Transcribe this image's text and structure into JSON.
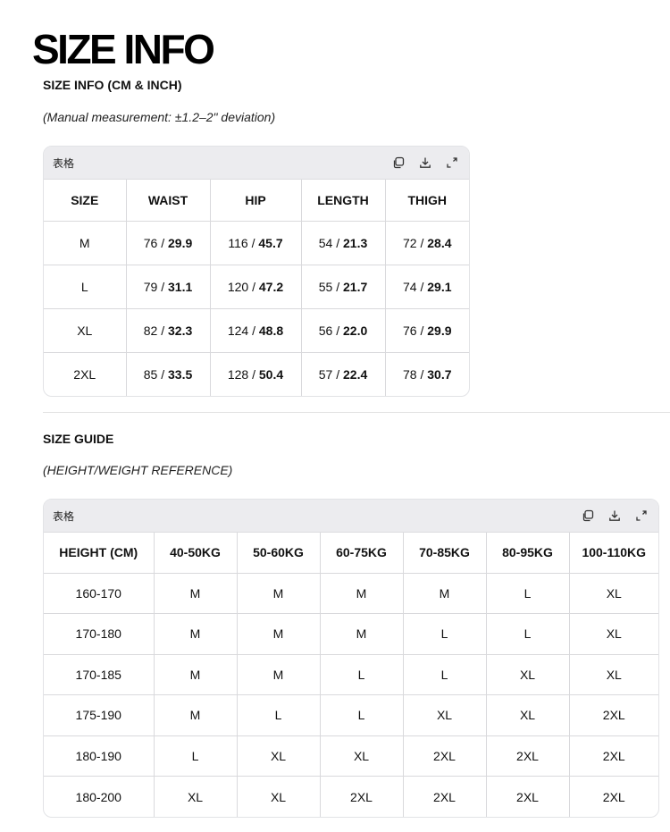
{
  "page_title": "SIZE INFO",
  "size_info": {
    "heading": "SIZE INFO (CM & INCH)",
    "note": "(Manual measurement: ±1.2–2\" deviation)",
    "toolbar_label": "表格",
    "columns": [
      "SIZE",
      "WAIST",
      "HIP",
      "LENGTH",
      "THIGH"
    ],
    "rows": [
      {
        "size": "M",
        "cells": [
          {
            "cm": "76",
            "inch": "29.9"
          },
          {
            "cm": "116",
            "inch": "45.7"
          },
          {
            "cm": "54",
            "inch": "21.3"
          },
          {
            "cm": "72",
            "inch": "28.4"
          }
        ]
      },
      {
        "size": "L",
        "cells": [
          {
            "cm": "79",
            "inch": "31.1"
          },
          {
            "cm": "120",
            "inch": "47.2"
          },
          {
            "cm": "55",
            "inch": "21.7"
          },
          {
            "cm": "74",
            "inch": "29.1"
          }
        ]
      },
      {
        "size": "XL",
        "cells": [
          {
            "cm": "82",
            "inch": "32.3"
          },
          {
            "cm": "124",
            "inch": "48.8"
          },
          {
            "cm": "56",
            "inch": "22.0"
          },
          {
            "cm": "76",
            "inch": "29.9"
          }
        ]
      },
      {
        "size": "2XL",
        "cells": [
          {
            "cm": "85",
            "inch": "33.5"
          },
          {
            "cm": "128",
            "inch": "50.4"
          },
          {
            "cm": "57",
            "inch": "22.4"
          },
          {
            "cm": "78",
            "inch": "30.7"
          }
        ]
      }
    ]
  },
  "size_guide": {
    "heading": "SIZE GUIDE",
    "note": "(HEIGHT/WEIGHT REFERENCE)",
    "toolbar_label": "表格",
    "columns": [
      "HEIGHT (CM)",
      "40-50KG",
      "50-60KG",
      "60-75KG",
      "70-85KG",
      "80-95KG",
      "100-110KG"
    ],
    "rows": [
      [
        "160-170",
        "M",
        "M",
        "M",
        "M",
        "L",
        "XL"
      ],
      [
        "170-180",
        "M",
        "M",
        "M",
        "L",
        "L",
        "XL"
      ],
      [
        "170-185",
        "M",
        "M",
        "L",
        "L",
        "XL",
        "XL"
      ],
      [
        "175-190",
        "M",
        "L",
        "L",
        "XL",
        "XL",
        "2XL"
      ],
      [
        "180-190",
        "L",
        "XL",
        "XL",
        "2XL",
        "2XL",
        "2XL"
      ],
      [
        "180-200",
        "XL",
        "XL",
        "2XL",
        "2XL",
        "2XL",
        "2XL"
      ]
    ]
  },
  "icons": [
    "copy-icon",
    "download-icon",
    "expand-icon"
  ]
}
